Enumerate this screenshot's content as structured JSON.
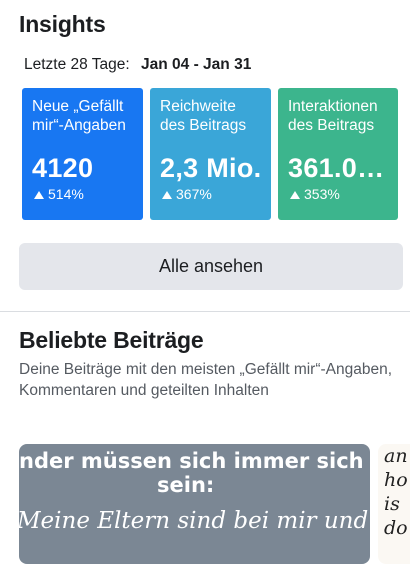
{
  "insights": {
    "title": "Insights",
    "period_label": "Letzte 28 Tage:",
    "period_range": "Jan 04 - Jan 31"
  },
  "cards": [
    {
      "title": "Neue „Gefällt mir“-Angaben",
      "value": "4120",
      "change": "514%",
      "color": "#1877f2",
      "trend_icon": "triangle-up-icon"
    },
    {
      "title": "Reichweite des Beitrags",
      "value": "2,3 Mio.",
      "change": "367%",
      "color": "#3aa6d8",
      "trend_icon": "triangle-up-icon"
    },
    {
      "title": "Interaktionen des Beitrags",
      "value": "361.0…",
      "change": "353%",
      "color": "#3cb58d",
      "trend_icon": "triangle-up-icon"
    }
  ],
  "see_all_label": "Alle ansehen",
  "popular": {
    "title": "Beliebte Beiträge",
    "description": "Deine Beiträge mit den meisten „Gefällt mir“-Angaben, Kommentaren und geteilten Inhalten",
    "posts": [
      {
        "line1": "nder müssen sich immer sich",
        "line2": "sein:",
        "line3": "Meine Eltern sind bei mir und lass"
      },
      {
        "text": "an ho is do"
      }
    ]
  }
}
